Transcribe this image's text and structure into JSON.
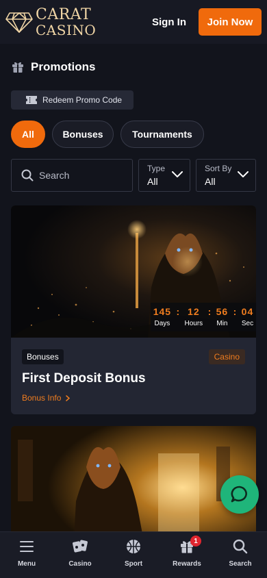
{
  "header": {
    "logo_line1": "CARAT",
    "logo_line2": "CASINO",
    "sign_in": "Sign In",
    "join_now": "Join Now"
  },
  "page": {
    "title": "Promotions",
    "redeem_label": "Redeem Promo Code"
  },
  "filters": {
    "chips": [
      "All",
      "Bonuses",
      "Tournaments"
    ],
    "active": "All"
  },
  "search": {
    "placeholder": "Search"
  },
  "selects": {
    "type": {
      "label": "Type",
      "value": "All"
    },
    "sort": {
      "label": "Sort By",
      "value": "All"
    }
  },
  "promotion": {
    "category": "Bonuses",
    "tag": "Casino",
    "title": "First Deposit Bonus",
    "link": "Bonus Info",
    "timer": {
      "days": "145",
      "hours": "12",
      "min": "56",
      "sec": "04",
      "days_label": "Days",
      "hours_label": "Hours",
      "min_label": "Min",
      "sec_label": "Sec"
    }
  },
  "bottom_nav": [
    {
      "label": "Menu",
      "icon": "menu-icon"
    },
    {
      "label": "Casino",
      "icon": "cards-icon"
    },
    {
      "label": "Sport",
      "icon": "ball-icon"
    },
    {
      "label": "Rewards",
      "icon": "gift-icon",
      "badge": "1"
    },
    {
      "label": "Search",
      "icon": "search-icon"
    }
  ],
  "colors": {
    "accent": "#f06a0c",
    "background": "#12141c",
    "card": "#232633",
    "chat": "#1fb57a",
    "logo_gold": "#f1d6a6"
  }
}
